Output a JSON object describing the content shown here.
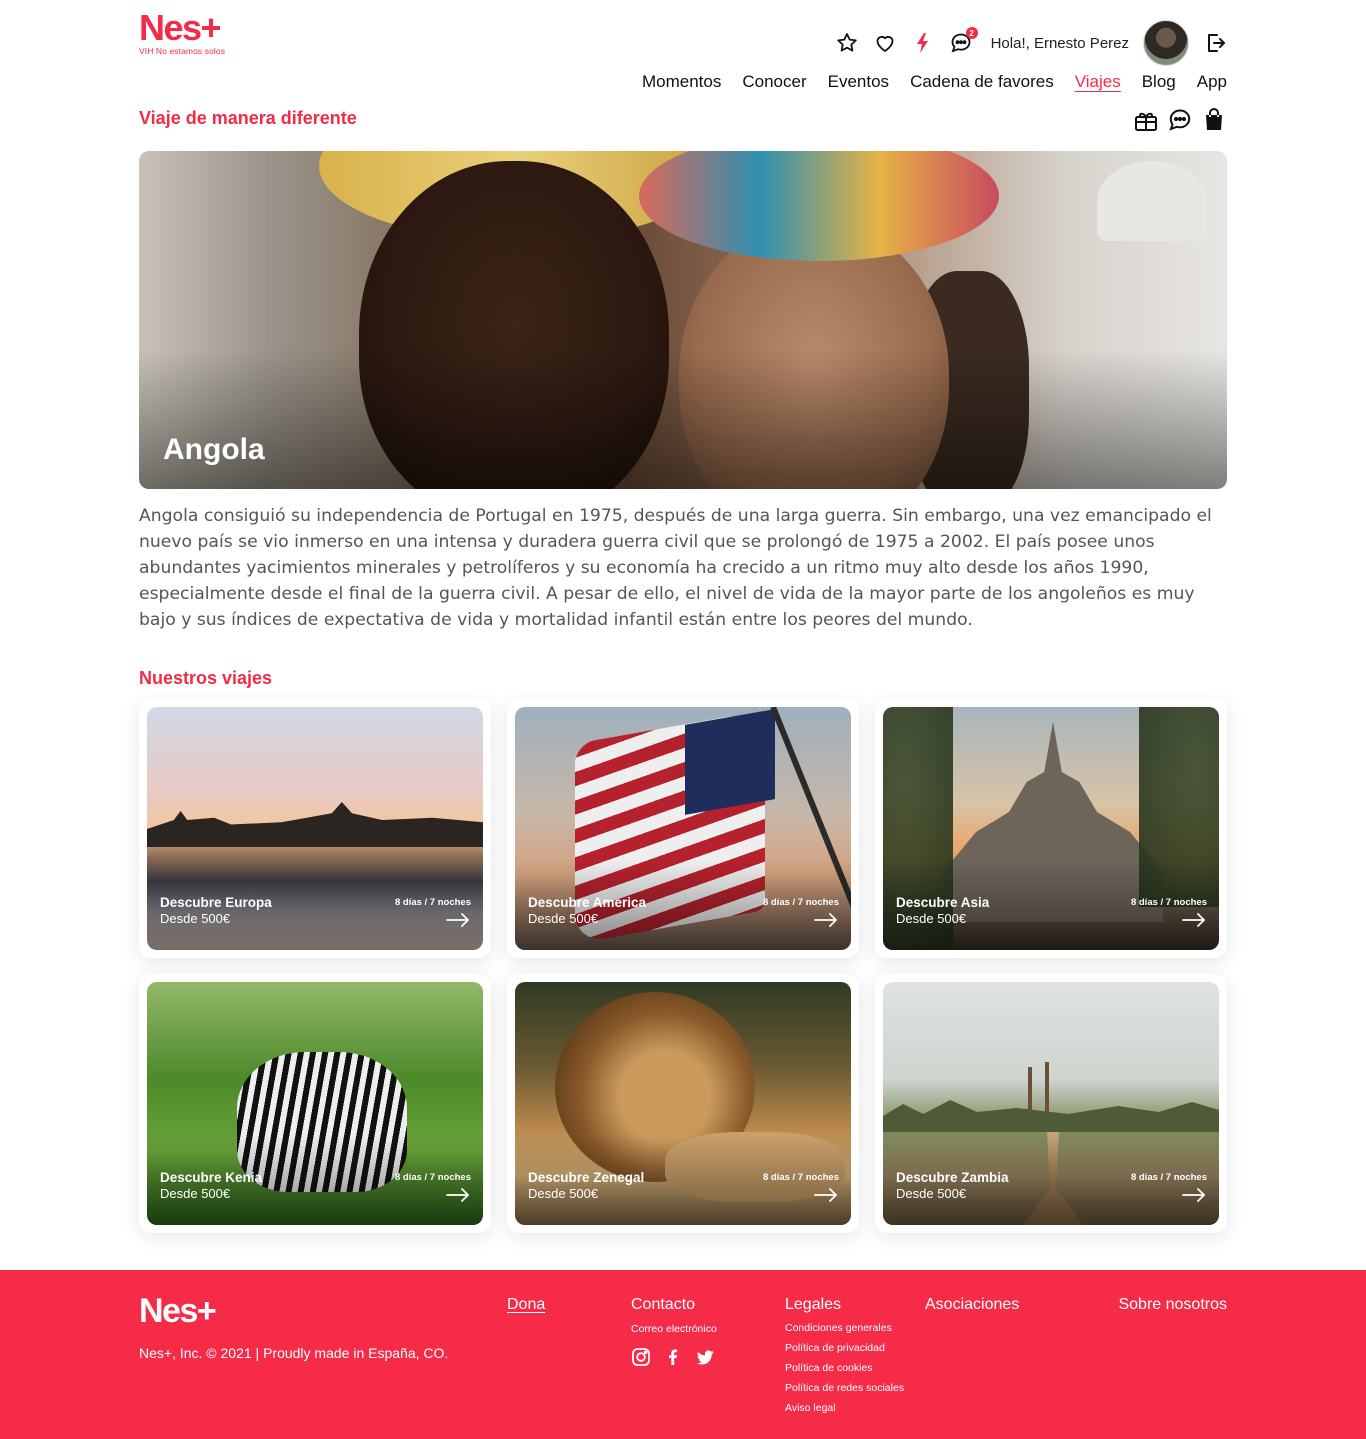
{
  "header": {
    "logo_text": "Nes+",
    "logo_tagline": "VIH No estamos solos",
    "greeting": "Hola!, Ernesto Perez",
    "message_badge": "2",
    "nav": [
      {
        "label": "Momentos"
      },
      {
        "label": "Conocer"
      },
      {
        "label": "Eventos"
      },
      {
        "label": "Cadena de favores"
      },
      {
        "label": "Viajes",
        "active": true
      },
      {
        "label": "Blog"
      },
      {
        "label": "App"
      }
    ],
    "icons": [
      "star-icon",
      "heart-icon",
      "bolt-icon",
      "chat-icon",
      "logout-icon"
    ]
  },
  "page": {
    "section_title": "Viaje de manera diferente",
    "action_icons": [
      "gift-icon",
      "chat-icon",
      "shopping-bag-icon"
    ]
  },
  "hero": {
    "title": "Angola",
    "description": "Angola consiguió su independencia de Portugal en 1975, después de una larga guerra. Sin embargo, una vez emancipado el nuevo país se vio inmerso en una intensa y duradera guerra civil que se prolongó de 1975 a 2002. El país posee unos abundantes yacimientos minerales y petrolíferos y su economía ha crecido a un ritmo muy alto desde los años 1990, especialmente desde el final de la guerra civil. A pesar de ello, el nivel de vida de la mayor parte de los angoleños es muy bajo y sus índices de expectativa de vida y mortalidad infantil están entre los peores del mundo."
  },
  "trips": {
    "title": "Nuestros viajes",
    "cards": [
      {
        "name": "Descubre Europa",
        "price": "Desde 500€",
        "duration": "8 días / 7 noches"
      },
      {
        "name": "Descubre America",
        "price": "Desde 500€",
        "duration": "8 días / 7 noches"
      },
      {
        "name": "Descubre Asia",
        "price": "Desde 500€",
        "duration": "8 días / 7 noches"
      },
      {
        "name": "Descubre Kenia",
        "price": "Desde 500€",
        "duration": "8 días / 7 noches"
      },
      {
        "name": "Descubre Zenegal",
        "price": "Desde 500€",
        "duration": "8 días / 7 noches"
      },
      {
        "name": "Descubre Zambia",
        "price": "Desde 500€",
        "duration": "8 días / 7 noches"
      }
    ]
  },
  "footer": {
    "logo_text": "Nes+",
    "copyright": "Nes+, Inc. © 2021 | Proudly made in España, CO.",
    "dona": "Dona",
    "contacto": {
      "title": "Contacto",
      "email_label": "Correo electrónico"
    },
    "legales": {
      "title": "Legales",
      "links": [
        "Condiciones generales",
        "Política de privacidad",
        "Política de cookies",
        "Política de redes sociales",
        "Aviso legal"
      ]
    },
    "asociaciones": "Asociaciones",
    "sobre_nosotros": "Sobre nosotros",
    "social": [
      "instagram-icon",
      "facebook-icon",
      "twitter-icon"
    ]
  },
  "colors": {
    "brand": "#f22b48",
    "footer_bg": "#f52b48",
    "text": "#222222",
    "desc_text": "#555555"
  }
}
